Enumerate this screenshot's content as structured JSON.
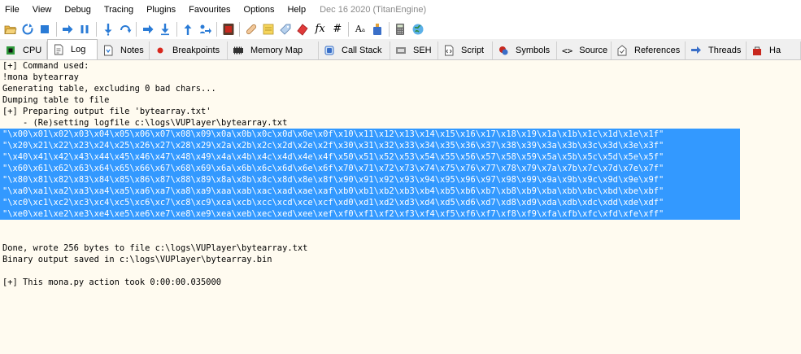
{
  "menu": {
    "items": [
      "File",
      "View",
      "Debug",
      "Tracing",
      "Plugins",
      "Favourites",
      "Options",
      "Help"
    ],
    "build_info": "Dec 16 2020 (TitanEngine)"
  },
  "toolbar": {
    "icons": [
      "open-icon",
      "restart-icon",
      "close-icon",
      "run-icon",
      "pause-icon",
      "step-into-icon",
      "step-over-icon",
      "trace-into-icon",
      "trace-over-icon",
      "execute-till-return-icon",
      "run-to-user-code-icon",
      "scylla-icon",
      "patch-icon",
      "comment-icon",
      "label-icon",
      "bookmark-icon",
      "function-icon",
      "hash-icon",
      "strings-icon",
      "calculator-icon",
      "globe-icon"
    ],
    "labels": {
      "function": "fx",
      "hash": "#",
      "strings": "Aₐ"
    }
  },
  "tabs": [
    {
      "label": "CPU",
      "icon": "cpu-icon",
      "active": false
    },
    {
      "label": "Log",
      "icon": "log-icon",
      "active": true
    },
    {
      "label": "Notes",
      "icon": "notes-icon",
      "active": false
    },
    {
      "label": "Breakpoints",
      "icon": "breakpoint-icon",
      "active": false
    },
    {
      "label": "Memory Map",
      "icon": "memory-map-icon",
      "active": false
    },
    {
      "label": "Call Stack",
      "icon": "call-stack-icon",
      "active": false
    },
    {
      "label": "SEH",
      "icon": "seh-icon",
      "active": false
    },
    {
      "label": "Script",
      "icon": "script-icon",
      "active": false
    },
    {
      "label": "Symbols",
      "icon": "symbols-icon",
      "active": false
    },
    {
      "label": "Source",
      "icon": "source-icon",
      "active": false
    },
    {
      "label": "References",
      "icon": "references-icon",
      "active": false
    },
    {
      "label": "Threads",
      "icon": "threads-icon",
      "active": false
    },
    {
      "label": "Ha",
      "icon": "handles-icon",
      "active": false
    }
  ],
  "log": {
    "lines": [
      {
        "text": "[+] Command used:",
        "selected": false
      },
      {
        "text": "!mona bytearray",
        "selected": false
      },
      {
        "text": "Generating table, excluding 0 bad chars...",
        "selected": false
      },
      {
        "text": "Dumping table to file",
        "selected": false
      },
      {
        "text": "[+] Preparing output file 'bytearray.txt'",
        "selected": false
      },
      {
        "text": "    - (Re)setting logfile c:\\logs\\VUPlayer\\bytearray.txt",
        "selected": false
      },
      {
        "text": "\"\\x00\\x01\\x02\\x03\\x04\\x05\\x06\\x07\\x08\\x09\\x0a\\x0b\\x0c\\x0d\\x0e\\x0f\\x10\\x11\\x12\\x13\\x14\\x15\\x16\\x17\\x18\\x19\\x1a\\x1b\\x1c\\x1d\\x1e\\x1f\"",
        "selected": true
      },
      {
        "text": "\"\\x20\\x21\\x22\\x23\\x24\\x25\\x26\\x27\\x28\\x29\\x2a\\x2b\\x2c\\x2d\\x2e\\x2f\\x30\\x31\\x32\\x33\\x34\\x35\\x36\\x37\\x38\\x39\\x3a\\x3b\\x3c\\x3d\\x3e\\x3f\"",
        "selected": true
      },
      {
        "text": "\"\\x40\\x41\\x42\\x43\\x44\\x45\\x46\\x47\\x48\\x49\\x4a\\x4b\\x4c\\x4d\\x4e\\x4f\\x50\\x51\\x52\\x53\\x54\\x55\\x56\\x57\\x58\\x59\\x5a\\x5b\\x5c\\x5d\\x5e\\x5f\"",
        "selected": true
      },
      {
        "text": "\"\\x60\\x61\\x62\\x63\\x64\\x65\\x66\\x67\\x68\\x69\\x6a\\x6b\\x6c\\x6d\\x6e\\x6f\\x70\\x71\\x72\\x73\\x74\\x75\\x76\\x77\\x78\\x79\\x7a\\x7b\\x7c\\x7d\\x7e\\x7f\"",
        "selected": true
      },
      {
        "text": "\"\\x80\\x81\\x82\\x83\\x84\\x85\\x86\\x87\\x88\\x89\\x8a\\x8b\\x8c\\x8d\\x8e\\x8f\\x90\\x91\\x92\\x93\\x94\\x95\\x96\\x97\\x98\\x99\\x9a\\x9b\\x9c\\x9d\\x9e\\x9f\"",
        "selected": true
      },
      {
        "text": "\"\\xa0\\xa1\\xa2\\xa3\\xa4\\xa5\\xa6\\xa7\\xa8\\xa9\\xaa\\xab\\xac\\xad\\xae\\xaf\\xb0\\xb1\\xb2\\xb3\\xb4\\xb5\\xb6\\xb7\\xb8\\xb9\\xba\\xbb\\xbc\\xbd\\xbe\\xbf\"",
        "selected": true
      },
      {
        "text": "\"\\xc0\\xc1\\xc2\\xc3\\xc4\\xc5\\xc6\\xc7\\xc8\\xc9\\xca\\xcb\\xcc\\xcd\\xce\\xcf\\xd0\\xd1\\xd2\\xd3\\xd4\\xd5\\xd6\\xd7\\xd8\\xd9\\xda\\xdb\\xdc\\xdd\\xde\\xdf\"",
        "selected": true
      },
      {
        "text": "\"\\xe0\\xe1\\xe2\\xe3\\xe4\\xe5\\xe6\\xe7\\xe8\\xe9\\xea\\xeb\\xec\\xed\\xee\\xef\\xf0\\xf1\\xf2\\xf3\\xf4\\xf5\\xf6\\xf7\\xf8\\xf9\\xfa\\xfb\\xfc\\xfd\\xfe\\xff\"",
        "selected": true
      },
      {
        "text": "",
        "selected": false
      },
      {
        "text": "",
        "selected": false
      },
      {
        "text": "Done, wrote 256 bytes to file c:\\logs\\VUPlayer\\bytearray.txt",
        "selected": false
      },
      {
        "text": "Binary output saved in c:\\logs\\VUPlayer\\bytearray.bin",
        "selected": false
      },
      {
        "text": "",
        "selected": false
      },
      {
        "text": "[+] This mona.py action took 0:00:00.035000",
        "selected": false
      }
    ]
  },
  "colors": {
    "selection": "#3399ff",
    "log_background": "#fffbf0"
  }
}
